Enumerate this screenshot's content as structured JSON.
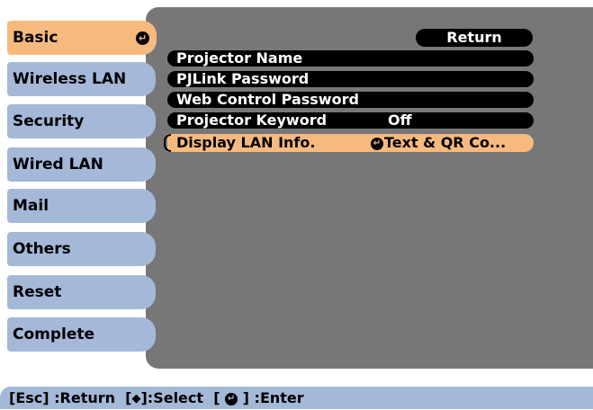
{
  "sidebar": {
    "items": [
      {
        "label": "Basic",
        "active": true
      },
      {
        "label": "Wireless LAN"
      },
      {
        "label": "Security"
      },
      {
        "label": "Wired LAN"
      },
      {
        "label": "Mail"
      },
      {
        "label": "Others"
      },
      {
        "label": "Reset"
      },
      {
        "label": "Complete"
      }
    ]
  },
  "menu": {
    "return_label": "Return",
    "rows": [
      {
        "label": "Projector Name",
        "value": ""
      },
      {
        "label": "PJLink Password",
        "value": ""
      },
      {
        "label": "Web Control Password",
        "value": ""
      },
      {
        "label": "Projector Keyword",
        "value": "Off"
      },
      {
        "label": "Display LAN Info.",
        "value": "Text & QR Co..."
      }
    ]
  },
  "help": {
    "esc_text": "[Esc] :Return",
    "select_text": "]:Select",
    "enter_text": "] :Enter"
  },
  "colors": {
    "active_tab": "#f7ba7e",
    "tab": "#a4b8d8",
    "panel": "#777777"
  },
  "icons": {
    "enter": "enter-icon",
    "updown": "up-down-arrows-icon"
  }
}
